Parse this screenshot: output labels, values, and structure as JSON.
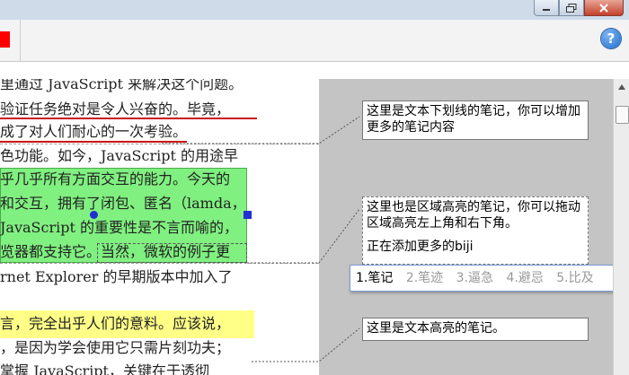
{
  "window": {
    "minimize_icon": "minimize-icon",
    "maximize_icon": "restore-icon",
    "close_icon": "close-icon"
  },
  "toolbar": {
    "help_label": "?"
  },
  "document": {
    "lines": [
      "里通过 JavaScript 来解决这个问题。",
      "验证任务绝对是令人兴奋的。毕竟，",
      "成了对人们耐心的一次考验。",
      "色功能。如今，JavaScript 的用途早",
      "乎几乎所有方面交互的能力。今天的",
      "和交互，拥有了闭包、匿名（lamda，",
      "JavaScript 的重要性是不言而喻的，",
      "览器都支持它。",
      "当然，微软的例子更",
      "rnet Explorer 的早期版本中加入了",
      "言，完全出乎人们的意料。应该说，",
      "，是因为学会使用它只需片刻功夫；",
      "掌握 JavaScript，关键在于透彻"
    ],
    "colors": {
      "underline": "#cc1111",
      "green_highlight": "#80f080",
      "yellow_highlight": "#ffff88"
    }
  },
  "notes": [
    {
      "text": "这里是文本下划线的笔记，你可以增加更多的笔记内容"
    },
    {
      "text_line1": "这里也是区域高亮的笔记，你可以拖动区域高亮左上角和右下角。",
      "text_line2": "正在添加更多的biji"
    },
    {
      "text": "这里是文本高亮的笔记。"
    }
  ],
  "ime_suggestions": {
    "items": [
      "1.笔记",
      "2.笔迹",
      "3.逼急",
      "4.避忌",
      "5.比及"
    ]
  }
}
